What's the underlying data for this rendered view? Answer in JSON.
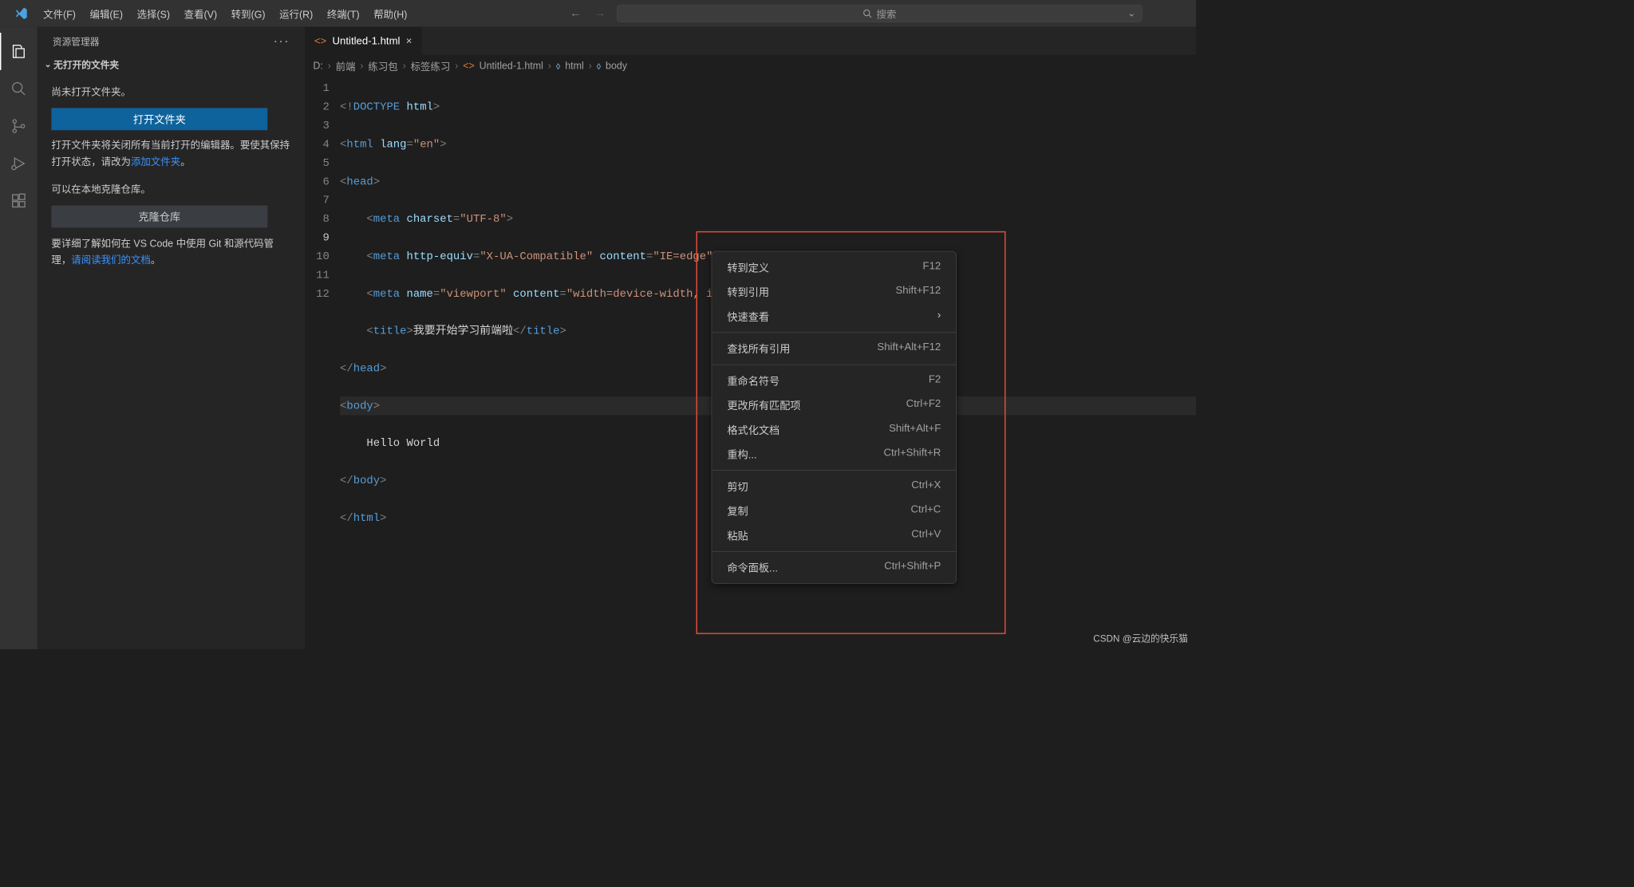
{
  "menu": [
    "文件(F)",
    "编辑(E)",
    "选择(S)",
    "查看(V)",
    "转到(G)",
    "运行(R)",
    "终端(T)",
    "帮助(H)"
  ],
  "search_placeholder": "搜索",
  "sidebar": {
    "title": "资源管理器",
    "section": "无打开的文件夹",
    "no_folder_text": "尚未打开文件夹。",
    "open_folder_btn": "打开文件夹",
    "note1_a": "打开文件夹将关闭所有当前打开的编辑器。要使其保持打开状态，请改为",
    "add_folder_link": "添加文件夹",
    "note1_b": "。",
    "note2": "可以在本地克隆仓库。",
    "clone_btn": "克隆仓库",
    "note3_a": "要详细了解如何在 VS Code 中使用 Git 和源代码管理，",
    "docs_link": "请阅读我们的文档",
    "note3_b": "。"
  },
  "tab": {
    "filename": "Untitled-1.html"
  },
  "breadcrumbs": [
    "D:",
    "前端",
    "练习包",
    "标签练习",
    "Untitled-1.html",
    "html",
    "body"
  ],
  "code": {
    "title_text": "我要开始学习前端啦",
    "hello": "Hello World"
  },
  "context_menu": [
    {
      "label": "转到定义",
      "shortcut": "F12"
    },
    {
      "label": "转到引用",
      "shortcut": "Shift+F12"
    },
    {
      "label": "快速查看",
      "sub": true
    },
    {
      "sep": true
    },
    {
      "label": "查找所有引用",
      "shortcut": "Shift+Alt+F12"
    },
    {
      "sep": true
    },
    {
      "label": "重命名符号",
      "shortcut": "F2"
    },
    {
      "label": "更改所有匹配项",
      "shortcut": "Ctrl+F2"
    },
    {
      "label": "格式化文档",
      "shortcut": "Shift+Alt+F"
    },
    {
      "label": "重构...",
      "shortcut": "Ctrl+Shift+R"
    },
    {
      "sep": true
    },
    {
      "label": "剪切",
      "shortcut": "Ctrl+X"
    },
    {
      "label": "复制",
      "shortcut": "Ctrl+C"
    },
    {
      "label": "粘贴",
      "shortcut": "Ctrl+V"
    },
    {
      "sep": true
    },
    {
      "label": "命令面板...",
      "shortcut": "Ctrl+Shift+P"
    }
  ],
  "watermark": "CSDN @云边的快乐猫"
}
